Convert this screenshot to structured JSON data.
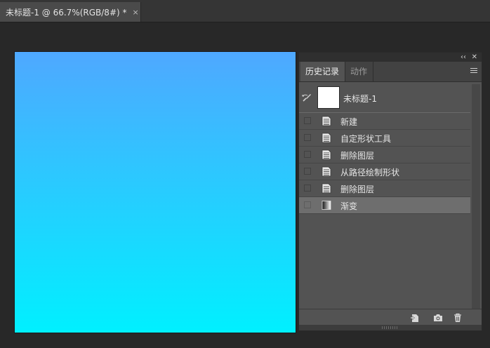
{
  "document_tab": {
    "title": "未标题-1 @ 66.7%(RGB/8#) *",
    "close_glyph": "×"
  },
  "canvas": {
    "gradient_top": "#4fa8ff",
    "gradient_bottom": "#00f0ff"
  },
  "history_panel": {
    "tabs": [
      "历史记录",
      "动作"
    ],
    "snapshot": {
      "label": "未标题-1",
      "icon": "history-brush-icon"
    },
    "steps": [
      {
        "label": "新建",
        "icon": "document-state-icon",
        "selected": false
      },
      {
        "label": "自定形状工具",
        "icon": "document-state-icon",
        "selected": false
      },
      {
        "label": "删除图层",
        "icon": "document-state-icon",
        "selected": false
      },
      {
        "label": "从路径绘制形状",
        "icon": "document-state-icon",
        "selected": false
      },
      {
        "label": "删除图层",
        "icon": "document-state-icon",
        "selected": false
      },
      {
        "label": "渐变",
        "icon": "gradient-state-icon",
        "selected": true
      }
    ],
    "footer_icons": [
      "new-document-from-state-icon",
      "camera-icon",
      "trash-icon"
    ],
    "header_icons": [
      "collapse-panel-icon",
      "close-panel-icon",
      "panel-menu-icon"
    ]
  }
}
